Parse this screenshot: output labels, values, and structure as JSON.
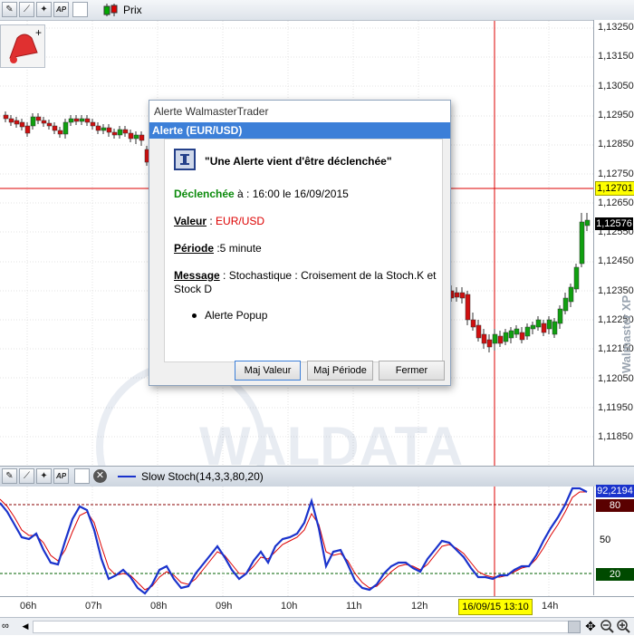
{
  "toolbar": {
    "prix_label": "Prix",
    "ap_label": "AP"
  },
  "price_axis": {
    "ticks": [
      "1,13250",
      "1,13150",
      "1,13050",
      "1,12950",
      "1,12850",
      "1,12750",
      "1,12650",
      "1,12550",
      "1,12450",
      "1,12350",
      "1,12250",
      "1,12150",
      "1,12050",
      "1,11950",
      "1,11850"
    ],
    "alert_level": "1,12701",
    "current_price": "1,12576",
    "alert_color": "#ffff00",
    "current_color": "#000000"
  },
  "dialog": {
    "window_title": "Alerte WalmasterTrader",
    "header": "Alerte (EUR/USD)",
    "headline": "\"Une Alerte vient d'être déclenchée\"",
    "trigger_label": "Déclenchée",
    "trigger_value": " à : 16:00 le 16/09/2015",
    "value_label": "Valeur",
    "value_sep": " : ",
    "value_value": "EUR/USD",
    "period_label": "Période",
    "period_value": " :5 minute",
    "message_label": "Message",
    "message_value": " : Stochastique : Croisement de la Stoch.K et Stock D",
    "bullet": "Alerte Popup",
    "buttons": {
      "update_value": "Maj Valeur",
      "update_period": "Maj Période",
      "close": "Fermer"
    }
  },
  "indicator": {
    "title": "Slow Stoch(14,3,3,80,20)",
    "current_value": "92,2194",
    "upper_level": "80",
    "mid_level": "50",
    "lower_level": "20"
  },
  "time_axis": {
    "labels": [
      "06h",
      "07h",
      "08h",
      "09h",
      "10h",
      "11h",
      "12h",
      "14h"
    ],
    "cursor_label": "16/09/15 13:10"
  },
  "watermark": {
    "brand_vertical": "Walmaster XP",
    "brand_bg": "WALDATA"
  }
}
